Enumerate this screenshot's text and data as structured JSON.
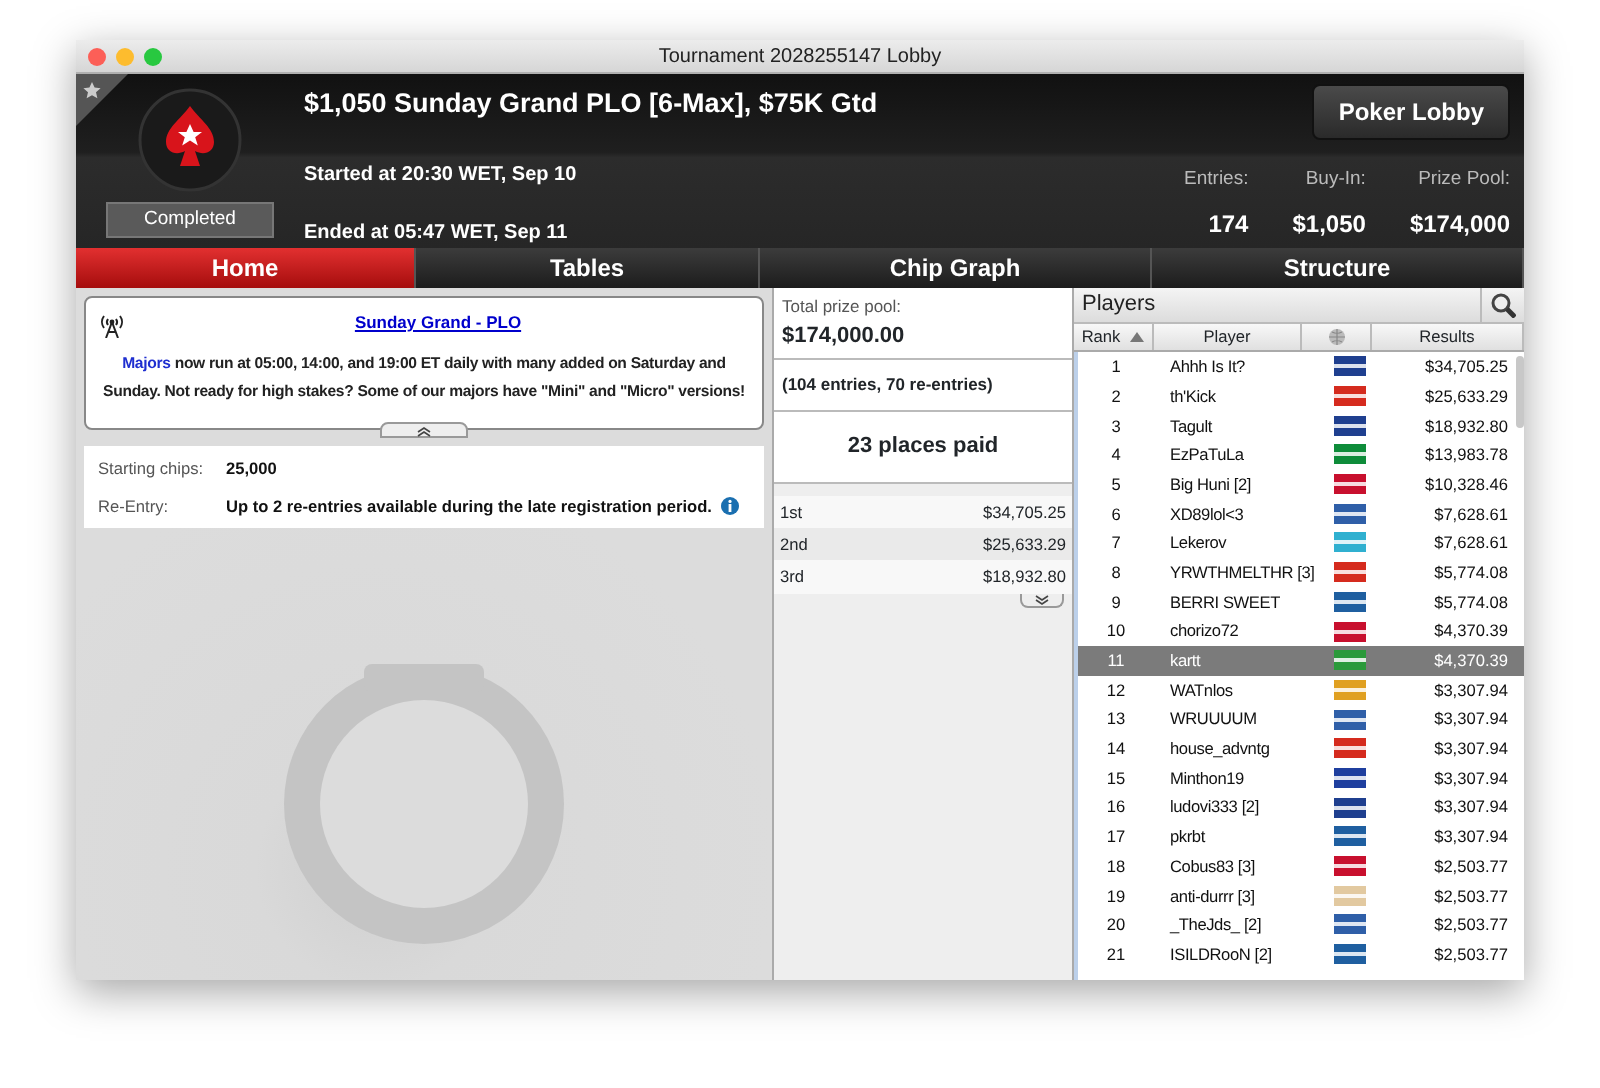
{
  "window": {
    "title": "Tournament 2028255147 Lobby"
  },
  "header": {
    "title": "$1,050 Sunday Grand PLO [6-Max], $75K Gtd",
    "started": "Started at 20:30 WET, Sep 10",
    "ended": "Ended at 05:47 WET, Sep 11",
    "status": "Completed",
    "button": "Poker Lobby",
    "stats": [
      {
        "label": "Entries:",
        "value": "174"
      },
      {
        "label": "Buy-In:",
        "value": "$1,050"
      },
      {
        "label": "Prize Pool:",
        "value": "$174,000"
      }
    ]
  },
  "tabs": [
    {
      "label": "Home",
      "selected": true
    },
    {
      "label": "Tables",
      "selected": false
    },
    {
      "label": "Chip Graph",
      "selected": false
    },
    {
      "label": "Structure",
      "selected": false
    }
  ],
  "news": {
    "title": "Sunday Grand - PLO",
    "body": "**Majors** now run at 05:00, 14:00, and 19:00 ET daily with many added on Saturday and Sunday. Not ready for high stakes? Some of our majors have \"Mini\" and \"Micro\" versions!"
  },
  "info": [
    {
      "label": "Starting chips:",
      "value": "25,000"
    },
    {
      "label": "Re-Entry:",
      "value": "Up to 2 re-entries available during the late registration period."
    }
  ],
  "prize": {
    "label": "Total prize pool:",
    "amount": "$174,000.00",
    "entries": "(104 entries, 70 re-entries)",
    "places": "23 places paid",
    "payouts": [
      {
        "place": "1st",
        "amount": "$34,705.25"
      },
      {
        "place": "2nd",
        "amount": "$25,633.29"
      },
      {
        "place": "3rd",
        "amount": "$18,932.80"
      }
    ]
  },
  "players": {
    "title": "Players",
    "columns": [
      "Rank",
      "Player",
      "Results"
    ],
    "rows": [
      {
        "rank": "1",
        "name": "Ahhh Is It?",
        "color": "#1f3f8f",
        "result": "$34,705.25",
        "selected": false
      },
      {
        "rank": "2",
        "name": "th'Kick",
        "color": "#d52b1e",
        "result": "$25,633.29",
        "selected": false
      },
      {
        "rank": "3",
        "name": "Tagult",
        "color": "#1f3f8f",
        "result": "$18,932.80",
        "selected": false
      },
      {
        "rank": "4",
        "name": "EzPaTuLa",
        "color": "#0e8c3a",
        "result": "$13,983.78",
        "selected": false
      },
      {
        "rank": "5",
        "name": "Big Huni [2]",
        "color": "#c8102e",
        "result": "$10,328.46",
        "selected": false
      },
      {
        "rank": "6",
        "name": "XD89lol<3",
        "color": "#2f5fa8",
        "result": "$7,628.61",
        "selected": false
      },
      {
        "rank": "7",
        "name": "Lekerov",
        "color": "#30b0d0",
        "result": "$7,628.61",
        "selected": false
      },
      {
        "rank": "8",
        "name": "YRWTHMELTHR [3]",
        "color": "#d52b1e",
        "result": "$5,774.08",
        "selected": false
      },
      {
        "rank": "9",
        "name": "BERRI SWEET",
        "color": "#1f5fa0",
        "result": "$5,774.08",
        "selected": false
      },
      {
        "rank": "10",
        "name": "chorizo72",
        "color": "#c8102e",
        "result": "$4,370.39",
        "selected": false
      },
      {
        "rank": "11",
        "name": "kartt",
        "color": "#2a9a3a",
        "result": "$4,370.39",
        "selected": true
      },
      {
        "rank": "12",
        "name": "WATnlos",
        "color": "#e0a020",
        "result": "$3,307.94",
        "selected": false
      },
      {
        "rank": "13",
        "name": "WRUUUUM",
        "color": "#2f5fa8",
        "result": "$3,307.94",
        "selected": false
      },
      {
        "rank": "14",
        "name": "house_advntg",
        "color": "#d52b1e",
        "result": "$3,307.94",
        "selected": false
      },
      {
        "rank": "15",
        "name": "Minthon19",
        "color": "#1f3f9f",
        "result": "$3,307.94",
        "selected": false
      },
      {
        "rank": "16",
        "name": "ludovi333 [2]",
        "color": "#1f3f8f",
        "result": "$3,307.94",
        "selected": false
      },
      {
        "rank": "17",
        "name": "pkrbt",
        "color": "#1f5fa0",
        "result": "$3,307.94",
        "selected": false
      },
      {
        "rank": "18",
        "name": "Cobus83 [3]",
        "color": "#c8102e",
        "result": "$2,503.77",
        "selected": false
      },
      {
        "rank": "19",
        "name": "anti-durrr [3]",
        "color": "#e2c9a0",
        "result": "$2,503.77",
        "selected": false
      },
      {
        "rank": "20",
        "name": "_TheJds_ [2]",
        "color": "#2f5fa8",
        "result": "$2,503.77",
        "selected": false
      },
      {
        "rank": "21",
        "name": "ISILDRooN [2]",
        "color": "#1f5fa0",
        "result": "$2,503.77",
        "selected": false
      }
    ]
  }
}
